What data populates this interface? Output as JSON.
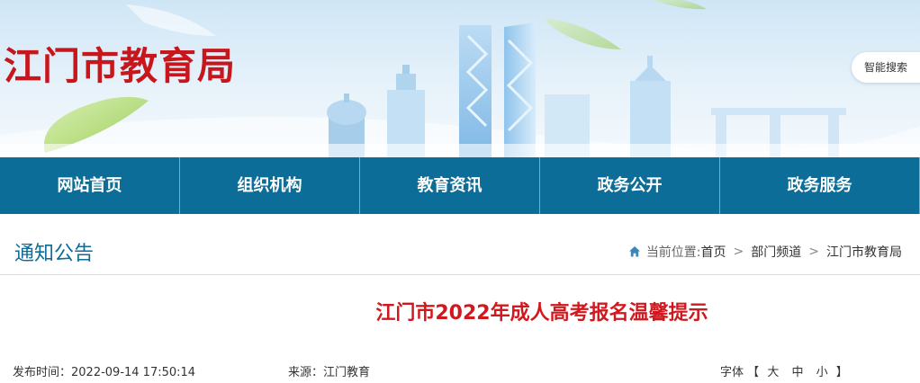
{
  "site": {
    "title": "江门市教育局",
    "smart_search": "智能搜索"
  },
  "nav": {
    "items": [
      "网站首页",
      "组织机构",
      "教育资讯",
      "政务公开",
      "政务服务"
    ]
  },
  "section": {
    "title": "通知公告"
  },
  "breadcrumb": {
    "label": "当前位置:",
    "items": [
      "首页",
      "部门频道",
      "江门市教育局"
    ],
    "separator": ">"
  },
  "article": {
    "title": "江门市2022年成人高考报名温馨提示",
    "publish_time": "发布时间：2022-09-14 17:50:14",
    "source": "来源：江门教育",
    "font_label": "字体",
    "font_open": "【",
    "font_options": [
      "大",
      "中",
      "小"
    ],
    "font_close": "】"
  },
  "colors": {
    "brand_red": "#c8161d",
    "nav_blue": "#0b6d98",
    "title_red": "#d0191f"
  },
  "icons": {
    "home": "home-icon"
  }
}
